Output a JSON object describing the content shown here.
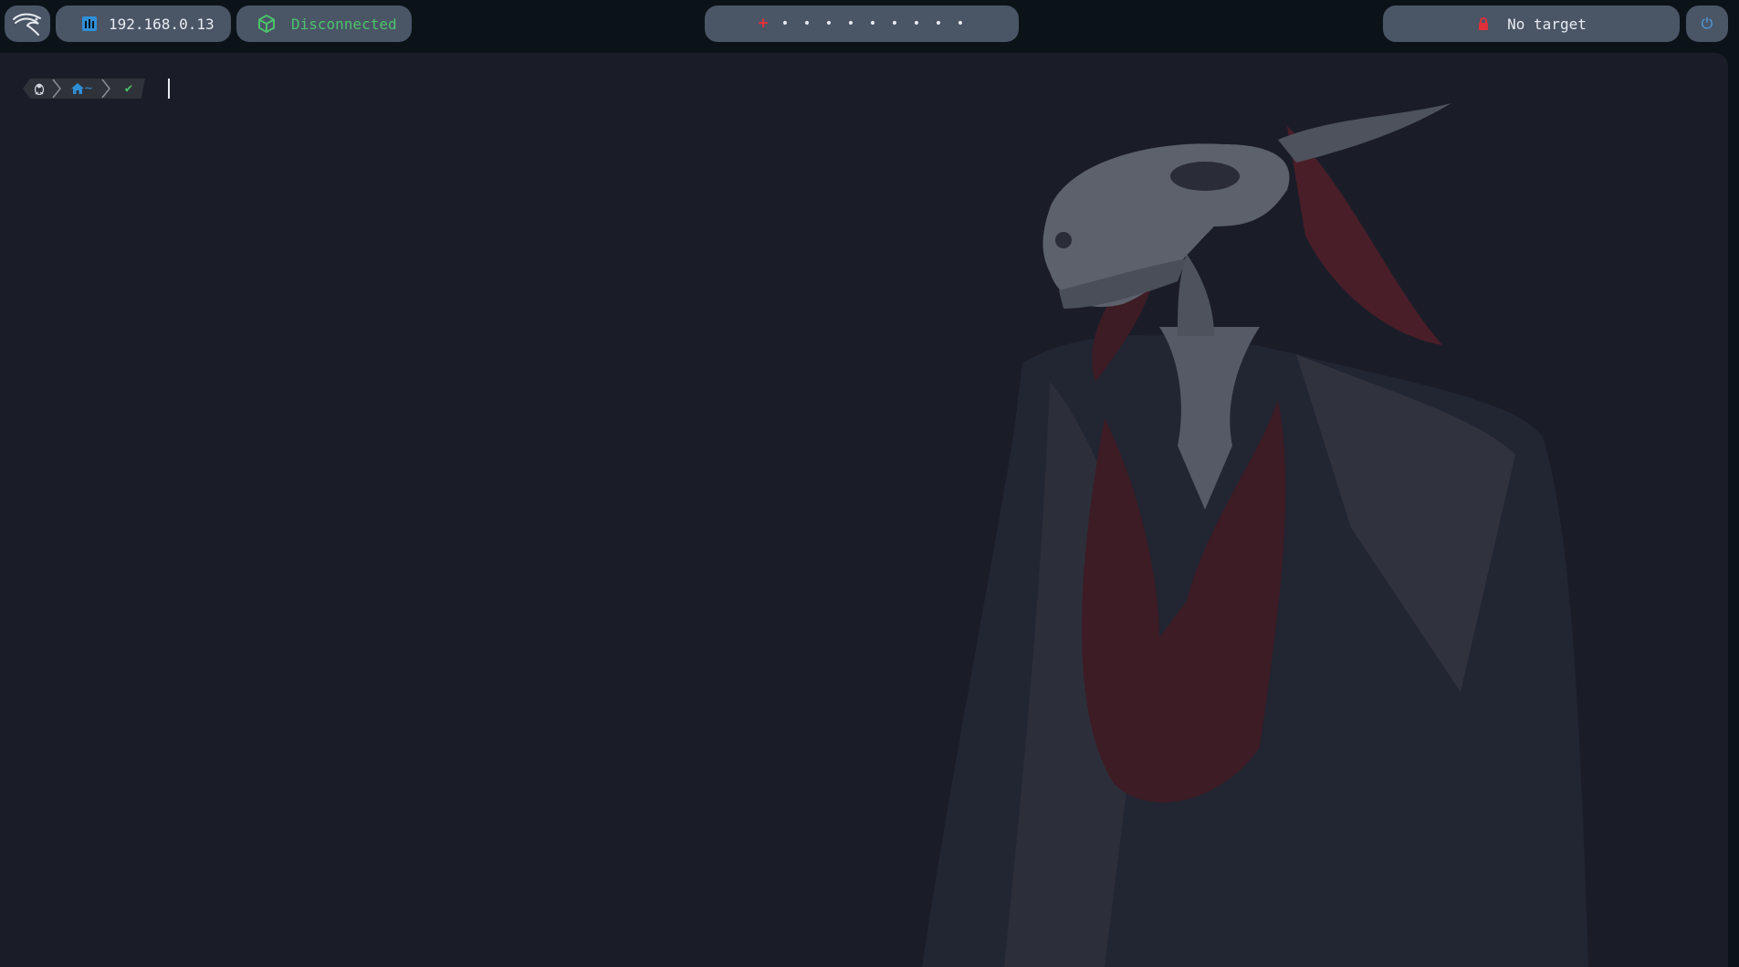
{
  "topbar": {
    "start_icon": "kali-dragon-icon",
    "ip_icon": "network-icon",
    "ip_address": "192.168.0.13",
    "vpn_icon": "box-icon",
    "vpn_status": "Disconnected",
    "workspaces": {
      "active_symbol": "+",
      "dots": [
        "•",
        "•",
        "•",
        "•",
        "•",
        "•",
        "•",
        "•",
        "•"
      ]
    },
    "target_icon": "lock-icon",
    "target_label": "No target",
    "power_icon": "power-icon",
    "power_symbol": "⏻"
  },
  "terminal": {
    "prompt": {
      "os_icon": "linux-penguin-icon",
      "os_glyph": "🐧",
      "dir_icon": "home-icon",
      "dir_label": "~",
      "status_glyph": "✔"
    }
  },
  "colors": {
    "accent_red": "#e0303a",
    "accent_green": "#4cc36b",
    "accent_blue": "#2e8fd8",
    "pill_bg": "#4a5566",
    "terminal_bg": "#1a1d28"
  }
}
